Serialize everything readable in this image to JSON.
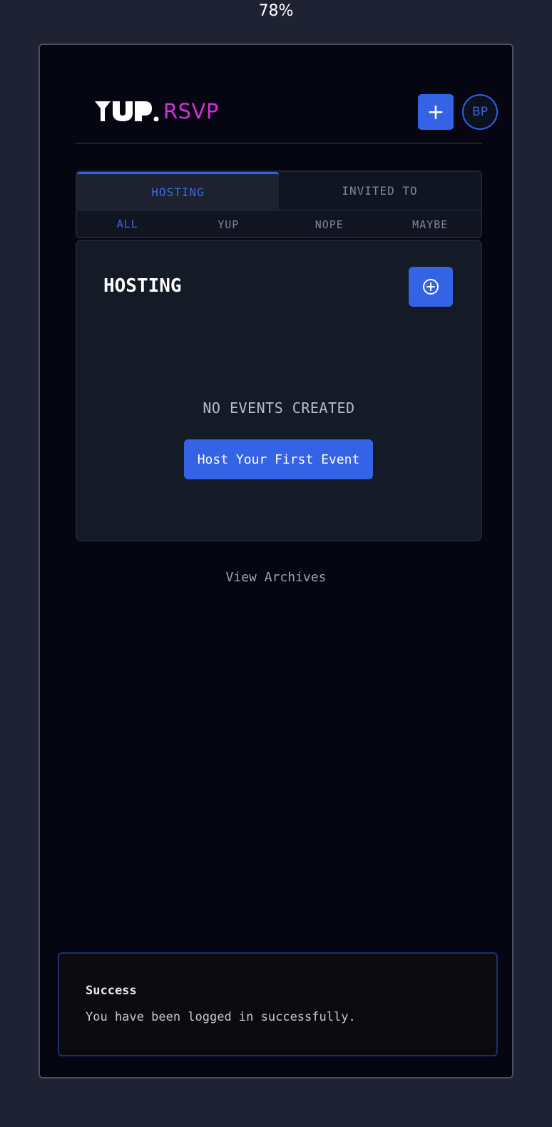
{
  "browser": {
    "zoom": "78%"
  },
  "header": {
    "logo_text": "YUP.",
    "logo_accent": "RSVP",
    "add_label": "+",
    "avatar_initials": "BP"
  },
  "tabs": {
    "main": [
      {
        "label": "HOSTING",
        "active": true
      },
      {
        "label": "INVITED TO",
        "active": false
      }
    ],
    "filters": [
      {
        "label": "ALL",
        "active": true
      },
      {
        "label": "YUP",
        "active": false
      },
      {
        "label": "NOPE",
        "active": false
      },
      {
        "label": "MAYBE",
        "active": false
      }
    ]
  },
  "card": {
    "title": "HOSTING",
    "empty_text": "NO EVENTS CREATED",
    "cta_label": "Host Your First Event"
  },
  "archives_link": "View Archives",
  "toast": {
    "title": "Success",
    "message": "You have been logged in successfully."
  },
  "colors": {
    "accent": "#3563e6",
    "brand_pink": "#d22fd6",
    "background": "#050611"
  }
}
